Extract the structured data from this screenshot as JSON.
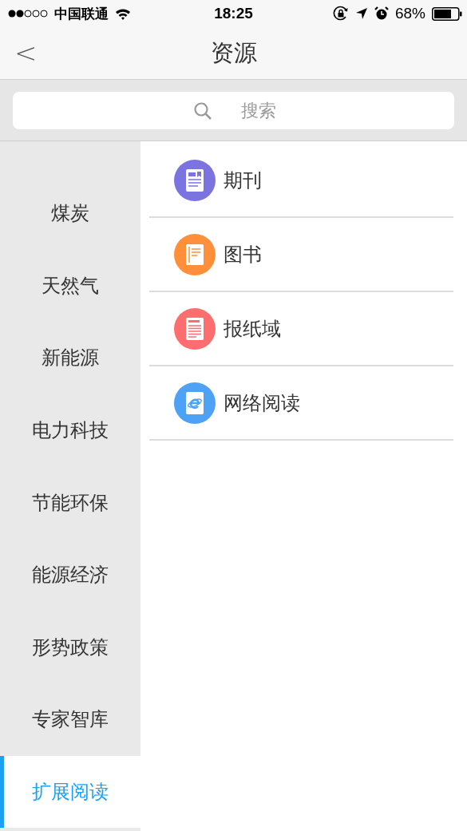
{
  "status_bar": {
    "carrier": "中国联通",
    "time": "18:25",
    "battery": "68%"
  },
  "nav": {
    "back": "<",
    "title": "资源"
  },
  "search": {
    "placeholder": "搜索"
  },
  "sidebar": {
    "items": [
      {
        "label": "煤炭",
        "selected": false
      },
      {
        "label": "天然气",
        "selected": false
      },
      {
        "label": "新能源",
        "selected": false
      },
      {
        "label": "电力科技",
        "selected": false
      },
      {
        "label": "节能环保",
        "selected": false
      },
      {
        "label": "能源经济",
        "selected": false
      },
      {
        "label": "形势政策",
        "selected": false
      },
      {
        "label": "专家智库",
        "selected": false
      },
      {
        "label": "扩展阅读",
        "selected": true
      }
    ]
  },
  "resources": [
    {
      "label": "期刊",
      "kind": "journal",
      "color": "#7b73e0"
    },
    {
      "label": "图书",
      "kind": "book",
      "color": "#ff8f3a"
    },
    {
      "label": "报纸域",
      "kind": "newspaper",
      "color": "#ff6e6e"
    },
    {
      "label": "网络阅读",
      "kind": "web",
      "color": "#4ea2f5"
    }
  ]
}
